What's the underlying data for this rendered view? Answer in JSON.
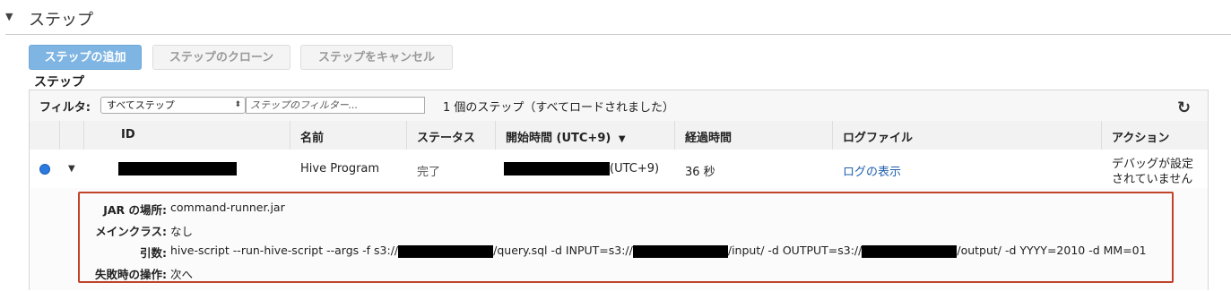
{
  "section": {
    "title": "ステップ",
    "toggle_icon": "triangle-down-icon"
  },
  "toolbar": {
    "add_step": "ステップの追加",
    "clone_step": "ステップのクローン",
    "cancel_step": "ステップをキャンセル"
  },
  "steps_label": "ステップ",
  "filter": {
    "label": "フィルタ:",
    "selected": "すべてステップ",
    "placeholder": "ステップのフィルター...",
    "status_text": "1 個のステップ（すべてロードされました）"
  },
  "table": {
    "headers": {
      "id": "ID",
      "name": "名前",
      "status": "ステータス",
      "start_time": "開始時間 (UTC+9)",
      "elapsed": "経過時間",
      "log_file": "ログファイル",
      "action": "アクション"
    },
    "sort_icon": "sort-desc-icon",
    "row": {
      "name": "Hive Program",
      "status": "完了",
      "start_time_suffix": "(UTC+9)",
      "elapsed": "36 秒",
      "log_link": "ログの表示",
      "action_line1": "デバッグが設定",
      "action_line2": "されていません"
    }
  },
  "details": {
    "jar_label": "JAR の場所:",
    "jar_value": "command-runner.jar",
    "main_class_label": "メインクラス:",
    "main_class_value": "なし",
    "args_label": "引数:",
    "args_part1": "hive-script --run-hive-script --args -f s3://",
    "args_part2": "/query.sql -d INPUT=s3://",
    "args_part3": "/input/ -d OUTPUT=s3://",
    "args_part4": "/output/ -d YYYY=2010 -d MM=01",
    "failure_label": "失敗時の操作:",
    "failure_value": "次へ"
  },
  "colors": {
    "primary": "#7fb5e3",
    "link": "#1f5fae",
    "highlight_border": "#c0432a",
    "radio": "#2a7ae2"
  }
}
